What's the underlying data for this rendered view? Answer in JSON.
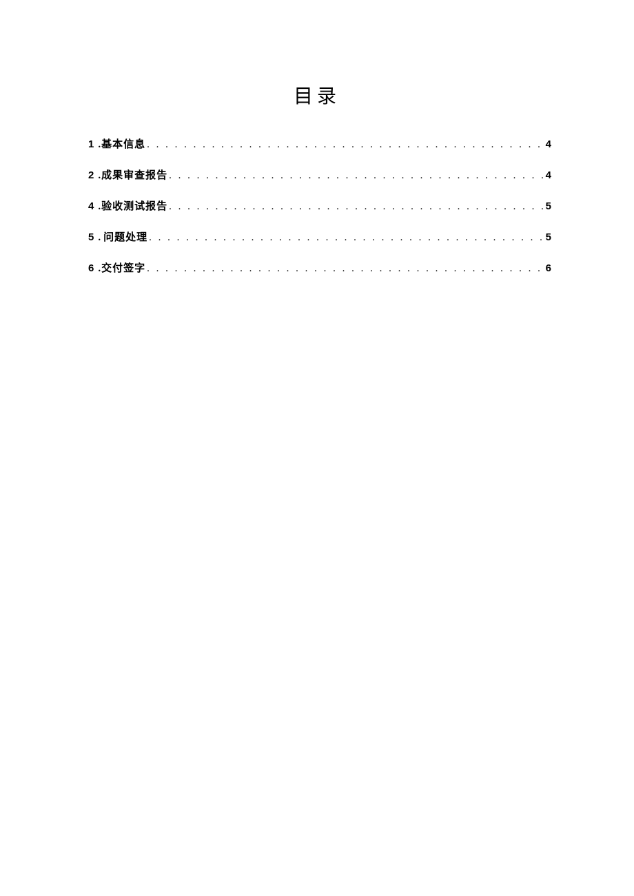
{
  "title": "目录",
  "entries": [
    {
      "number": "1",
      "separator": ".",
      "label": "基本信息",
      "page": "4"
    },
    {
      "number": "2",
      "separator": ".",
      "label": "成果审查报告",
      "page": "4"
    },
    {
      "number": "4",
      "separator": ".",
      "label": "验收测试报告",
      "page": "5"
    },
    {
      "number": "5",
      "separator": ".",
      "label": "问题处理",
      "page": "5"
    },
    {
      "number": "6",
      "separator": ".",
      "label": "交付签字",
      "page": "6"
    }
  ]
}
